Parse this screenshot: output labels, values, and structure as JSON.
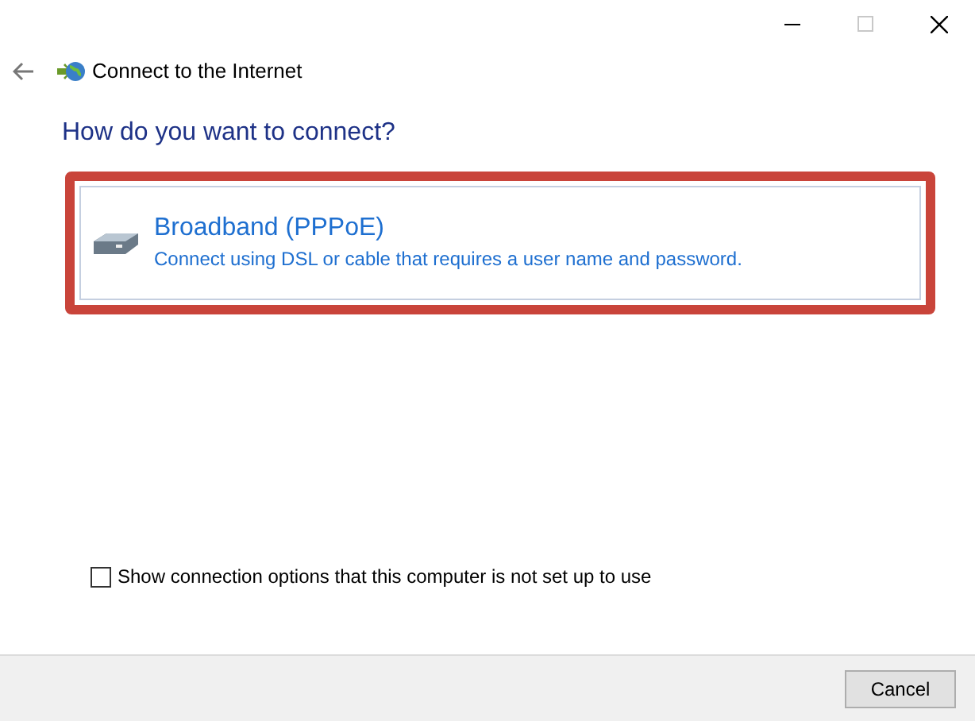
{
  "window": {
    "title": "Connect to the Internet"
  },
  "heading": "How do you want to connect?",
  "options": [
    {
      "title": "Broadband (PPPoE)",
      "description": "Connect using DSL or cable that requires a user name and password.",
      "highlighted": true
    }
  ],
  "show_all_option": {
    "label": "Show connection options that this computer is not set up to use",
    "checked": false
  },
  "buttons": [
    "Cancel"
  ]
}
